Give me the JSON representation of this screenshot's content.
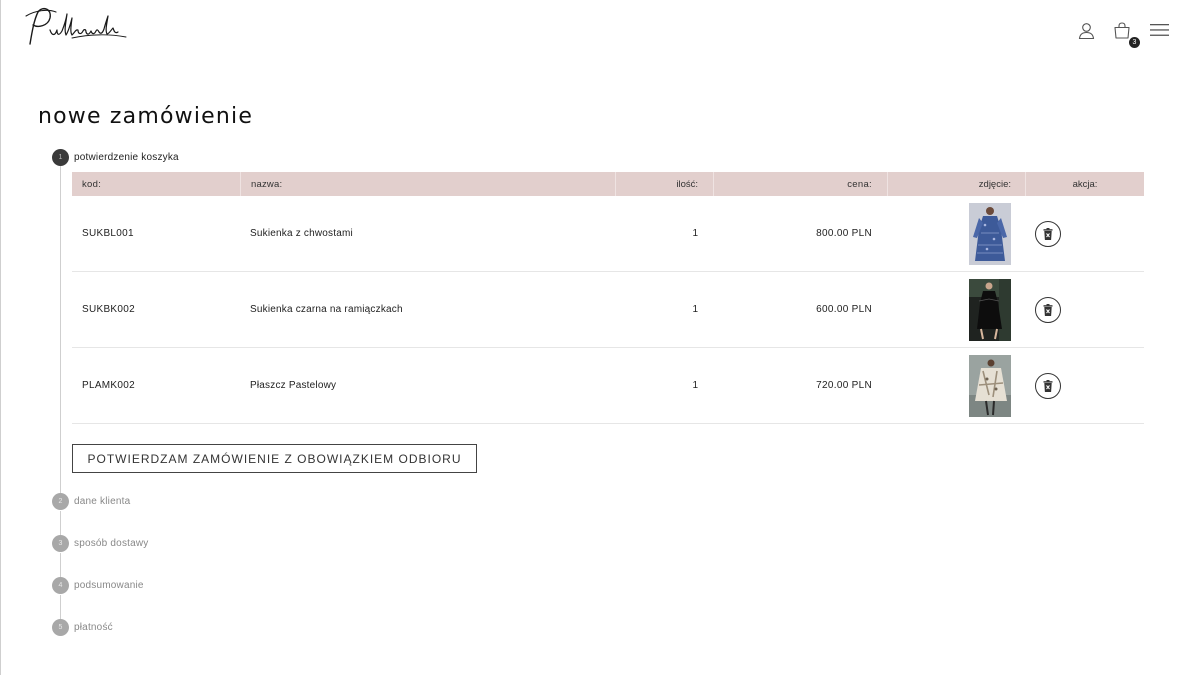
{
  "brand": {
    "logo_text": "Pudłowska"
  },
  "header": {
    "cart_count": "3"
  },
  "page_title": "nowe zamówienie",
  "steps": [
    {
      "number": "1",
      "label": "potwierdzenie koszyka"
    },
    {
      "number": "2",
      "label": "dane klienta"
    },
    {
      "number": "3",
      "label": "sposób dostawy"
    },
    {
      "number": "4",
      "label": "podsumowanie"
    },
    {
      "number": "5",
      "label": "płatność"
    }
  ],
  "table": {
    "headers": {
      "kod": "kod:",
      "nazwa": "nazwa:",
      "ilosc": "ilość:",
      "cena": "cena:",
      "zdjecie": "zdjęcie:",
      "akcja": "akcja:"
    },
    "rows": [
      {
        "kod": "SUKBL001",
        "nazwa": "Sukienka z chwostami",
        "ilosc": "1",
        "cena": "800.00 PLN"
      },
      {
        "kod": "SUKBK002",
        "nazwa": "Sukienka czarna na ramiączkach",
        "ilosc": "1",
        "cena": "600.00 PLN"
      },
      {
        "kod": "PLAMK002",
        "nazwa": "Płaszcz Pastelowy",
        "ilosc": "1",
        "cena": "720.00 PLN"
      }
    ]
  },
  "confirm_button": "POTWIERDZAM ZAMÓWIENIE Z OBOWIĄZKIEM ODBIORU",
  "colors": {
    "table_header_bg": "#e2cfcd",
    "active_step": "#3a3a3a",
    "inactive_step": "#a8a8a8"
  },
  "icons": {
    "account": "user-icon",
    "cart": "shopping-bag-icon",
    "menu": "hamburger-menu-icon",
    "remove": "trash-icon"
  }
}
